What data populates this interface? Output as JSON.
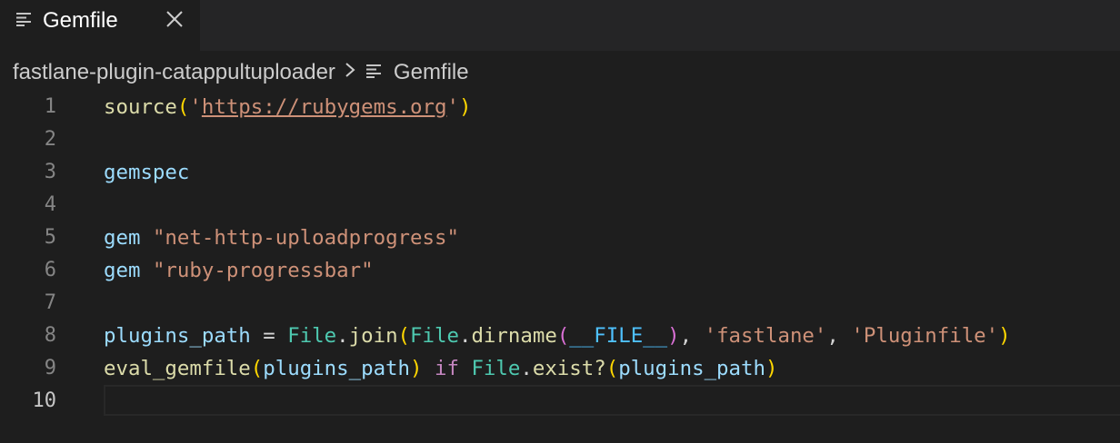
{
  "tab": {
    "label": "Gemfile",
    "file_icon": "lines-icon",
    "close_icon": "close-icon"
  },
  "breadcrumb": {
    "folder": "fastlane-plugin-catappultuploader",
    "separator_icon": "chevron-right-icon",
    "file": "Gemfile"
  },
  "editor": {
    "active_line": "10",
    "lines": [
      {
        "num": "1",
        "tokens": {
          "a": "source",
          "b": "(",
          "c": "'",
          "d": "https://rubygems.org",
          "e": "'",
          "f": ")"
        }
      },
      {
        "num": "2"
      },
      {
        "num": "3",
        "tokens": {
          "a": "gemspec"
        }
      },
      {
        "num": "4"
      },
      {
        "num": "5",
        "tokens": {
          "a": "gem",
          "b": " ",
          "c": "\"net-http-uploadprogress\""
        }
      },
      {
        "num": "6",
        "tokens": {
          "a": "gem",
          "b": " ",
          "c": "\"ruby-progressbar\""
        }
      },
      {
        "num": "7"
      },
      {
        "num": "8",
        "tokens": {
          "a": "plugins_path",
          "b": " = ",
          "c": "File",
          "d": ".",
          "e": "join",
          "f": "(",
          "g": "File",
          "h": ".",
          "i": "dirname",
          "j": "(",
          "k": "__FILE__",
          "l": ")",
          "m": ", ",
          "n": "'fastlane'",
          "o": ", ",
          "p": "'Pluginfile'",
          "q": ")"
        }
      },
      {
        "num": "9",
        "tokens": {
          "a": "eval_gemfile",
          "b": "(",
          "c": "plugins_path",
          "d": ")",
          "e": " ",
          "f": "if",
          "g": " ",
          "h": "File",
          "i": ".",
          "j": "exist?",
          "k": "(",
          "l": "plugins_path",
          "m": ")"
        }
      },
      {
        "num": "10"
      }
    ]
  },
  "colors": {
    "background": "#1e1e1e",
    "tabbar": "#252526",
    "function": "#dcdcaa",
    "variable": "#9cdcfe",
    "string": "#ce9178",
    "class": "#4ec9b0",
    "keyword": "#c586c0",
    "constant": "#4fc1ff",
    "bracket_level1": "#ffd700",
    "bracket_level2": "#da70d6",
    "bracket_level3": "#179fff"
  }
}
